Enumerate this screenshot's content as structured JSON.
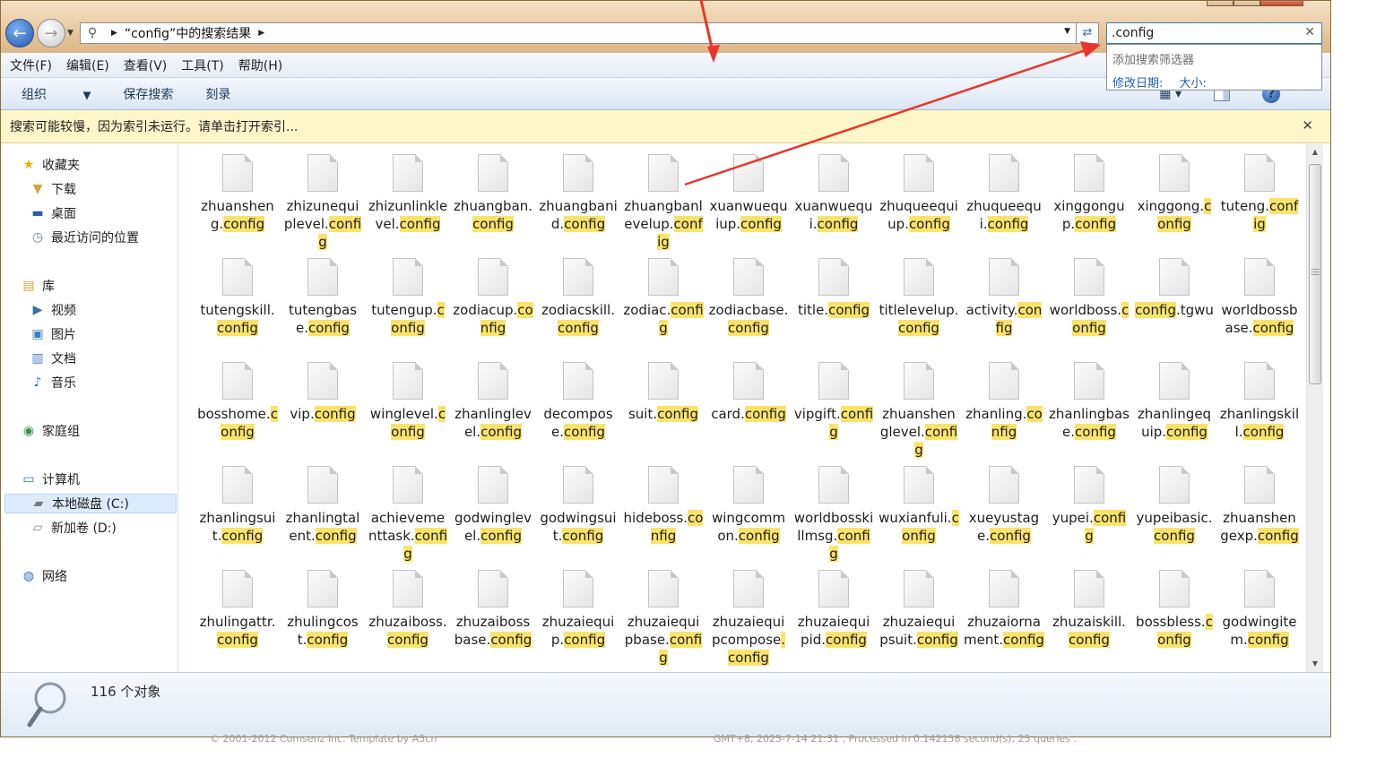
{
  "window": {
    "address": {
      "crumb": "“config”中的搜索结果"
    },
    "search": {
      "value": ".config",
      "popup_title": "添加搜索筛选器",
      "filter_date": "修改日期:",
      "filter_size": "大小:"
    },
    "menu": [
      "文件(F)",
      "编辑(E)",
      "查看(V)",
      "工具(T)",
      "帮助(H)"
    ],
    "toolbar": {
      "organize": "组织",
      "save_search": "保存搜索",
      "burn": "刻录"
    },
    "info_bar": "搜索可能较慢，因为索引未运行。请单击打开索引...",
    "nav": [
      {
        "label": "收藏夹",
        "icon": "star-icon"
      },
      {
        "label": "下载",
        "icon": "folder-download-icon"
      },
      {
        "label": "桌面",
        "icon": "desktop-icon"
      },
      {
        "label": "最近访问的位置",
        "icon": "recent-places-icon"
      },
      {
        "label": "库",
        "icon": "library-icon"
      },
      {
        "label": "视频",
        "icon": "video-icon"
      },
      {
        "label": "图片",
        "icon": "picture-icon"
      },
      {
        "label": "文档",
        "icon": "document-icon"
      },
      {
        "label": "音乐",
        "icon": "music-icon"
      },
      {
        "label": "家庭组",
        "icon": "homegroup-icon"
      },
      {
        "label": "计算机",
        "icon": "computer-icon"
      },
      {
        "label": "本地磁盘 (C:)",
        "icon": "drive-c-icon"
      },
      {
        "label": "新加卷 (D:)",
        "icon": "drive-d-icon"
      },
      {
        "label": "网络",
        "icon": "network-icon"
      }
    ],
    "files": [
      [
        "zhuanshen",
        "g.",
        "config"
      ],
      [
        "zhizunequi",
        "plevel.",
        "con",
        "fig"
      ],
      [
        "zhizunlinkl",
        "evel.",
        "confi",
        "g"
      ],
      [
        "zhuangba",
        "n.",
        "config"
      ],
      [
        "zhuangba",
        "nid.",
        "config"
      ],
      [
        "zhuangba",
        "nlevelup.",
        "c",
        "onfig"
      ],
      [
        "xuanwueq",
        "uiup.",
        "confi",
        "g"
      ],
      [
        "xuanwueq",
        "ui.",
        "config"
      ],
      [
        "zhuqueeq",
        "uiup.",
        "confi",
        "g"
      ],
      [
        "zhuqueeq",
        "ui.",
        "config"
      ],
      [
        "xinggong",
        "up.",
        "config"
      ],
      [
        "xinggong.",
        "",
        "config"
      ],
      [
        "tuteng.",
        "",
        "co",
        "nfig"
      ],
      [
        "tutengskill",
        "",
        ".config"
      ],
      [
        "tutengbas",
        "e.",
        "config"
      ],
      [
        "tutengup.",
        "",
        "config"
      ],
      [
        "zodiacup.",
        "",
        "c",
        "onfig"
      ],
      [
        "zodiacskill.",
        "",
        "config"
      ],
      [
        "zodiac.",
        "",
        "con",
        "fig"
      ],
      [
        "zodiacbas",
        "e.",
        "config"
      ],
      [
        "title.",
        "",
        "confi",
        "g"
      ],
      [
        "titlelevelu",
        "p.",
        "config"
      ],
      [
        "activity.",
        "",
        "co",
        "nfig"
      ],
      [
        "worldboss",
        "",
        ".config"
      ],
      [
        "",
        "",
        "config",
        ".tgw",
        "u"
      ],
      [
        "worldboss",
        "base.",
        "confi",
        "g"
      ],
      [
        "bosshome",
        "",
        ".config"
      ],
      [
        "vip.",
        "",
        "config"
      ],
      [
        "winglevel.",
        "",
        "config"
      ],
      [
        "zhanlingle",
        "vel.",
        "config"
      ],
      [
        "decompos",
        "e.",
        "config"
      ],
      [
        "suit.",
        "",
        "config"
      ],
      [
        "card.",
        "",
        "confi",
        "g"
      ],
      [
        "vipgift.",
        "",
        "con",
        "fig"
      ],
      [
        "zhuanshen",
        "glevel.",
        "con",
        "fig"
      ],
      [
        "zhanling.",
        "",
        "c",
        "onfig"
      ],
      [
        "zhanlingba",
        "se.",
        "config"
      ],
      [
        "zhanlinge",
        "quip.",
        "confi",
        "g"
      ],
      [
        "zhanlingsk",
        "ill.",
        "config"
      ],
      [
        "zhanlingsu",
        "it.",
        "config"
      ],
      [
        "zhanlingtal",
        "ent.",
        "config"
      ],
      [
        "achieveme",
        "nttask.",
        "con",
        "fig"
      ],
      [
        "godwingle",
        "vel.",
        "config"
      ],
      [
        "godwings",
        "uit.",
        "config"
      ],
      [
        "hideboss.",
        "",
        "c",
        "onfig"
      ],
      [
        "wingcom",
        "mon.",
        "confi",
        "g"
      ],
      [
        "worldboss",
        "killmsg.",
        "co",
        "nfig"
      ],
      [
        "wuxianfuli.",
        "",
        "config"
      ],
      [
        "xueyustag",
        "e.",
        "config"
      ],
      [
        "yupei.",
        "",
        "conf",
        "ig"
      ],
      [
        "yupeibasic",
        "",
        ".config"
      ],
      [
        "zhuanshen",
        "gexp.",
        "confi",
        "g"
      ],
      [
        "zhulingattr",
        "",
        ".config"
      ],
      [
        "zhulingcos",
        "t.",
        "config"
      ],
      [
        "zhuzaiboss",
        "",
        ".config"
      ],
      [
        "zhuzaiboss",
        "base.",
        "confi",
        "g"
      ],
      [
        "zhuzaiequi",
        "p.",
        "config"
      ],
      [
        "zhuzaiequi",
        "pbase.",
        "con",
        "fig"
      ],
      [
        "zhuzaiequi",
        "pcompose",
        "",
        ".config"
      ],
      [
        "zhuzaiequi",
        "pid.",
        "config"
      ],
      [
        "zhuzaiequi",
        "psuit.",
        "confi",
        "g"
      ],
      [
        "zhuzaiorna",
        "ment.",
        "confi",
        "g"
      ],
      [
        "zhuzaiskill.",
        "",
        "config"
      ],
      [
        "bossbless.",
        "",
        "config"
      ],
      [
        "godwingit",
        "em.",
        "config"
      ]
    ],
    "status": {
      "count": "116 个对象"
    },
    "behind_left": "© 2001-2012 Comsenz Inc. Template by A5cn",
    "behind_right": "GMT+8, 2025-7-14 21:31 , Processed in 0.142158 second(s), 25 queries ."
  }
}
